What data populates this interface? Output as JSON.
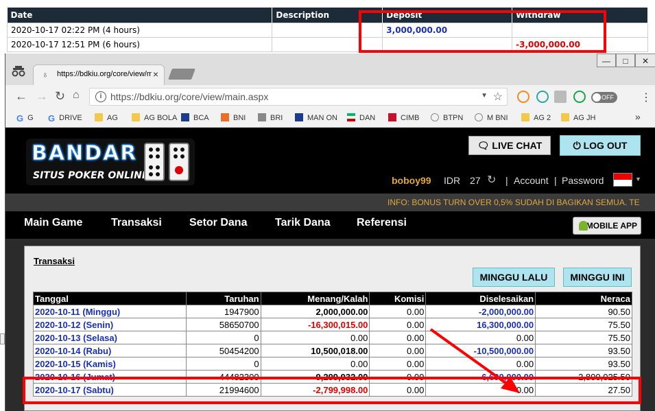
{
  "bg_table": {
    "headers": [
      "Date",
      "Description",
      "Deposit",
      "Withdraw"
    ],
    "rows": [
      {
        "date": "2020-10-17 02:22 PM (4 hours)",
        "description": "",
        "deposit": "3,000,000.00",
        "withdraw": ""
      },
      {
        "date": "2020-10-17 12:51 PM (6 hours)",
        "description": "",
        "deposit": "",
        "withdraw": "-3,000,000.00"
      }
    ]
  },
  "browser": {
    "tab_title": "https://bdkiu.org/core/view/main.aspx",
    "url": "https://bdkiu.org/core/view/main.aspx",
    "toggle_label": "OFF",
    "window_controls": [
      "—",
      "□",
      "✕"
    ],
    "bookmarks": [
      {
        "label": "G",
        "icon": "google-icon"
      },
      {
        "label": "DRIVE",
        "icon": "google-icon"
      },
      {
        "label": "AG",
        "icon": "folder-icon"
      },
      {
        "label": "AG BOLA",
        "icon": "folder-icon"
      },
      {
        "label": "BCA",
        "icon": "bca-icon"
      },
      {
        "label": "BNI",
        "icon": "bni-icon"
      },
      {
        "label": "BRI",
        "icon": "bri-icon"
      },
      {
        "label": "MAN ON",
        "icon": "mandiri-icon"
      },
      {
        "label": "DAN",
        "icon": "danamon-icon"
      },
      {
        "label": "CIMB",
        "icon": "cimb-icon"
      },
      {
        "label": "BTPN",
        "icon": "ring-icon"
      },
      {
        "label": "M BNI",
        "icon": "ring-icon"
      },
      {
        "label": "AG 2",
        "icon": "folder-icon"
      },
      {
        "label": "AG JH",
        "icon": "folder-icon"
      }
    ],
    "bookmarks_overflow": "»"
  },
  "site": {
    "logo_title": "BANDAR",
    "logo_subtitle": "SITUS POKER ONLINE",
    "live_chat_label": "LIVE CHAT",
    "logout_label": "LOG OUT",
    "username": "boboy99",
    "currency": "IDR",
    "balance": "27",
    "account_link": "Account",
    "separator": "|",
    "password_link": "Password",
    "marquee_text": "INFO: BONUS TURN OVER 0,5% SUDAH DI BAGIKAN SEMUA. TE",
    "nav": [
      "Main Game",
      "Transaksi",
      "Setor Dana",
      "Tarik Dana",
      "Referensi"
    ],
    "mobile_app_label": "MOBILE APP",
    "panel_title": "Transaksi",
    "btn_last_week": "MINGGU LALU",
    "btn_this_week": "MINGGU INI",
    "table": {
      "headers": [
        "Tanggal",
        "Taruhan",
        "Menang/Kalah",
        "Komisi",
        "Diselesaikan",
        "Neraca"
      ],
      "rows": [
        {
          "tanggal": "2020-10-11 (Minggu)",
          "taruhan": "1947900",
          "menang": "2,000,000.00",
          "komisi": "0.00",
          "diselesaikan": "-2,000,000.00",
          "neraca": "90.50"
        },
        {
          "tanggal": "2020-10-12 (Senin)",
          "taruhan": "58650700",
          "menang": "-16,300,015.00",
          "komisi": "0.00",
          "diselesaikan": "16,300,000.00",
          "neraca": "75.50"
        },
        {
          "tanggal": "2020-10-13 (Selasa)",
          "taruhan": "0",
          "menang": "0.00",
          "komisi": "0.00",
          "diselesaikan": "0.00",
          "neraca": "75.50"
        },
        {
          "tanggal": "2020-10-14 (Rabu)",
          "taruhan": "50454200",
          "menang": "10,500,018.00",
          "komisi": "0.00",
          "diselesaikan": "-10,500,000.00",
          "neraca": "93.50"
        },
        {
          "tanggal": "2020-10-15 (Kamis)",
          "taruhan": "0",
          "menang": "0.00",
          "komisi": "0.00",
          "diselesaikan": "0.00",
          "neraca": "93.50"
        },
        {
          "tanggal": "2020-10-16 (Jumat)",
          "taruhan": "44482300",
          "menang": "9,299,932.00",
          "komisi": "0.00",
          "diselesaikan": "-6,600,000.00",
          "neraca": "2,800,025.50"
        },
        {
          "tanggal": "2020-10-17 (Sabtu)",
          "taruhan": "21994600",
          "menang": "-2,799,998.00",
          "komisi": "0.00",
          "diselesaikan": "0.00",
          "neraca": "27.50"
        }
      ]
    }
  },
  "colors": {
    "annotation": "#ff0000",
    "accent_cyan": "#aee4f0",
    "username_gold": "#e0a93d",
    "link_blue": "#1a2fb8",
    "negative_red": "#e00000"
  }
}
